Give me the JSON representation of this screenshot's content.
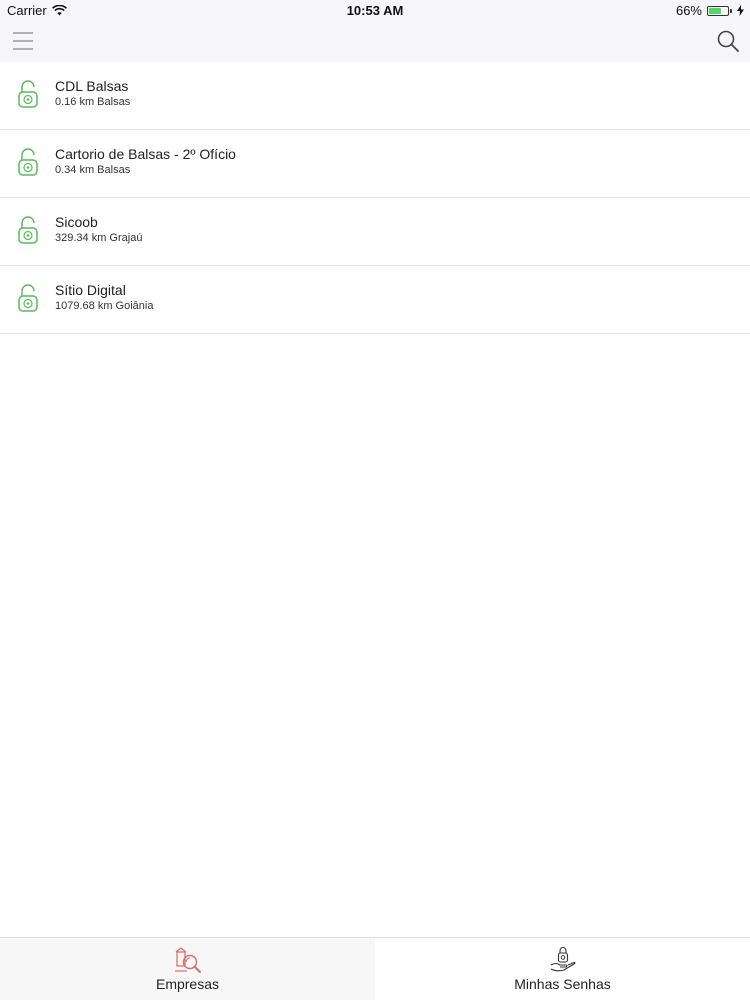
{
  "status_bar": {
    "carrier": "Carrier",
    "time": "10:53 AM",
    "battery": "66%",
    "battery_level": 0.66
  },
  "nav": {
    "menu_icon": "hamburger-menu-icon",
    "search_icon": "search-icon"
  },
  "list": {
    "items": [
      {
        "title": "CDL Balsas",
        "subtitle": "0.16 km Balsas",
        "icon": "unlocked-padlock-icon"
      },
      {
        "title": "Cartorio de Balsas - 2º Ofício",
        "subtitle": "0.34 km Balsas",
        "icon": "unlocked-padlock-icon"
      },
      {
        "title": "Sicoob",
        "subtitle": "329.34 km Grajaú",
        "icon": "unlocked-padlock-icon"
      },
      {
        "title": "Sítio Digital",
        "subtitle": "1079.68 km Goiânia",
        "icon": "unlocked-padlock-icon"
      }
    ]
  },
  "tabs": [
    {
      "label": "Empresas",
      "icon": "company-search-icon",
      "active": true
    },
    {
      "label": "Minhas Senhas",
      "icon": "hand-padlock-icon",
      "active": false
    }
  ],
  "colors": {
    "accent_green": "#5cb85c",
    "active_tab_icon": "#e06a6a",
    "bar_background": "#f6f6f8"
  }
}
